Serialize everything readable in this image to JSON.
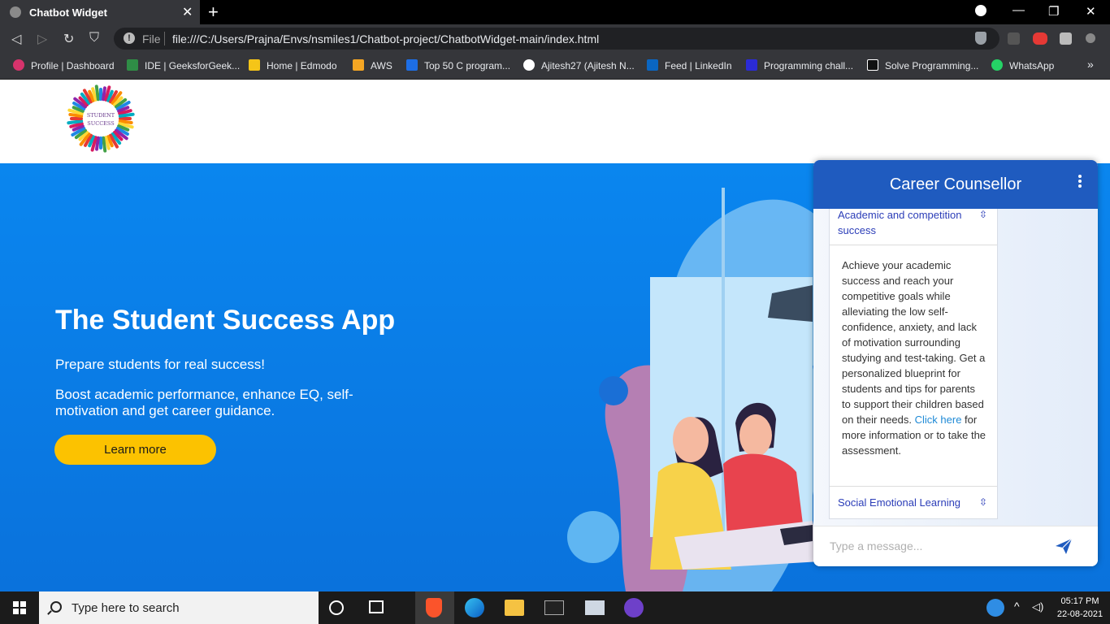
{
  "browser": {
    "tab_title": "Chatbot Widget",
    "tab_close": "✕",
    "new_tab": "+",
    "address_label": "File",
    "url": "file:///C:/Users/Prajna/Envs/nsmiles1/Chatbot-project/ChatbotWidget-main/index.html",
    "bookmarks": [
      {
        "label": "Profile | Dashboard",
        "color": "#d6336c"
      },
      {
        "label": "IDE | GeeksforGeek...",
        "color": "#2f8d46"
      },
      {
        "label": "Home | Edmodo",
        "color": "#f5c518"
      },
      {
        "label": "AWS",
        "color": "#f5a623"
      },
      {
        "label": "Top 50 C program...",
        "color": "#1d6ee6"
      },
      {
        "label": "Ajitesh27 (Ajitesh N...",
        "color": "#ffffff"
      },
      {
        "label": "Feed | LinkedIn",
        "color": "#0a66c2"
      },
      {
        "label": "Programming chall...",
        "color": "#2b2bd6"
      },
      {
        "label": "Solve Programming...",
        "color": "#111111"
      },
      {
        "label": "WhatsApp",
        "color": "#25d366"
      }
    ]
  },
  "hero": {
    "title": "The Student Success App",
    "subtitle": "Prepare students for real success!",
    "description": "Boost academic performance, enhance EQ, self-motivation and get career guidance.",
    "cta_label": "Learn more"
  },
  "logo": {
    "text_line1": "STUDENT",
    "text_line2": "SUCCESS"
  },
  "chat": {
    "title": "Career Counsellor",
    "accordion_1_title": "Academic and competition success",
    "accordion_1_body_before_link": "Achieve your academic success and reach your competitive goals while alleviating the low self-confidence, anxiety, and lack of motivation surrounding studying and test-taking. Get a personalized blueprint for students and tips for parents to support their children based on their needs. ",
    "accordion_1_link": "Click here",
    "accordion_1_body_after_link": " for more information or to take the assessment.",
    "accordion_2_title": "Social Emotional Learning",
    "input_placeholder": "Type a message..."
  },
  "taskbar": {
    "search_placeholder": "Type here to search",
    "time": "05:17 PM",
    "date": "22-08-2021"
  },
  "colors": {
    "chat_header": "#1f5bbf",
    "hero_bg": "#0a86ef",
    "cta": "#fcc200",
    "link": "#1f8ad6"
  }
}
